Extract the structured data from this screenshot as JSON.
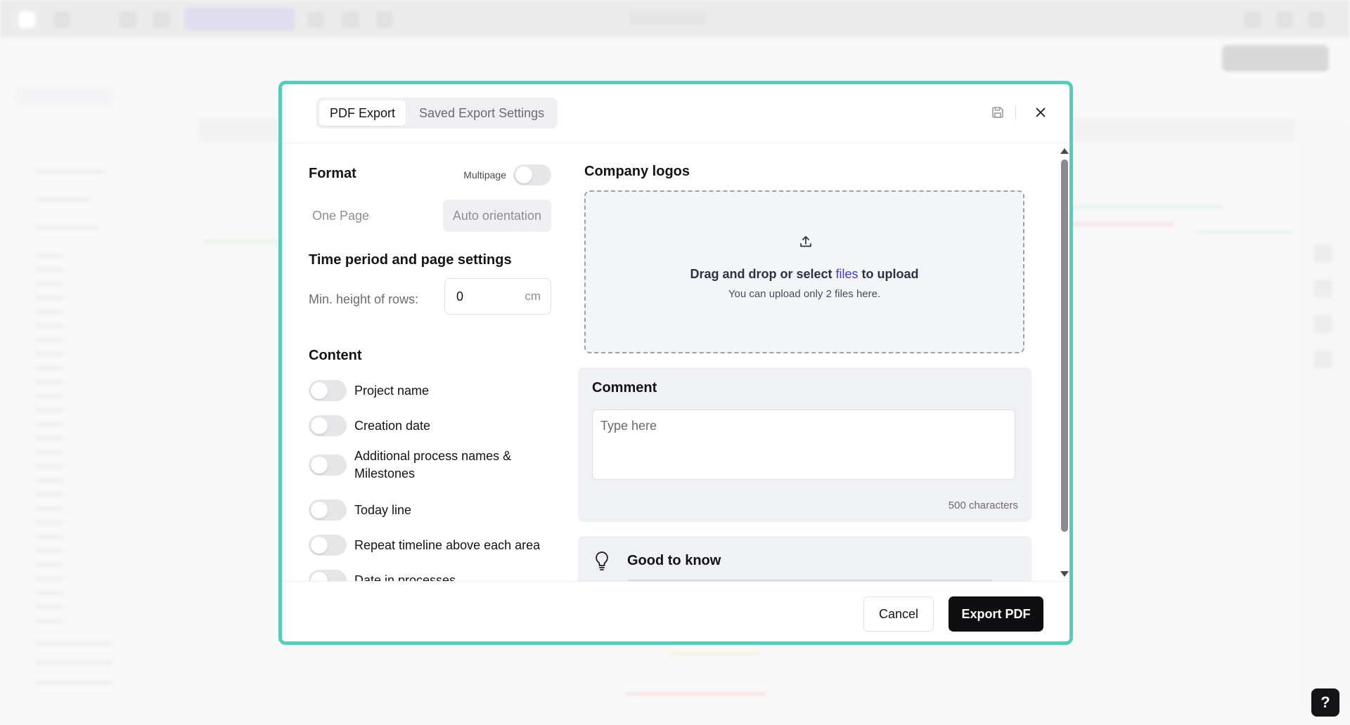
{
  "dialog": {
    "tabs": [
      {
        "label": "PDF Export",
        "active": true
      },
      {
        "label": "Saved Export Settings",
        "active": false
      }
    ],
    "header_icons": [
      "save-icon",
      "close-icon"
    ]
  },
  "format": {
    "title": "Format",
    "multipage_label": "Multipage",
    "multipage_on": false,
    "options": [
      {
        "label": "One Page",
        "selected": false
      },
      {
        "label": "Auto orientation",
        "selected": true
      }
    ]
  },
  "time_period": {
    "title": "Time period and page settings",
    "min_height_label": "Min. height of rows:",
    "min_height_value": "0",
    "min_height_unit": "cm"
  },
  "content": {
    "title": "Content",
    "options": [
      {
        "label": "Project name",
        "on": false
      },
      {
        "label": "Creation date",
        "on": false
      },
      {
        "label": "Additional process names & Milestones",
        "on": false
      },
      {
        "label": "Today line",
        "on": false
      },
      {
        "label": "Repeat timeline above each area",
        "on": false
      },
      {
        "label": "Date in processes",
        "on": false
      }
    ]
  },
  "logos": {
    "title": "Company logos",
    "drop_text_before": "Drag and drop or select ",
    "drop_link": "files",
    "drop_text_after": " to upload",
    "drop_hint": "You can upload only 2 files here."
  },
  "comment": {
    "title": "Comment",
    "placeholder": "Type here",
    "value": "",
    "char_limit": "500 characters"
  },
  "good_to_know": {
    "title": "Good to know"
  },
  "footer": {
    "cancel_label": "Cancel",
    "export_label": "Export PDF"
  },
  "help": {
    "label": "?"
  },
  "colors": {
    "dialog_border": "#54cdbd",
    "link": "#3b3bd1",
    "primary_button": "#0f0f11"
  }
}
